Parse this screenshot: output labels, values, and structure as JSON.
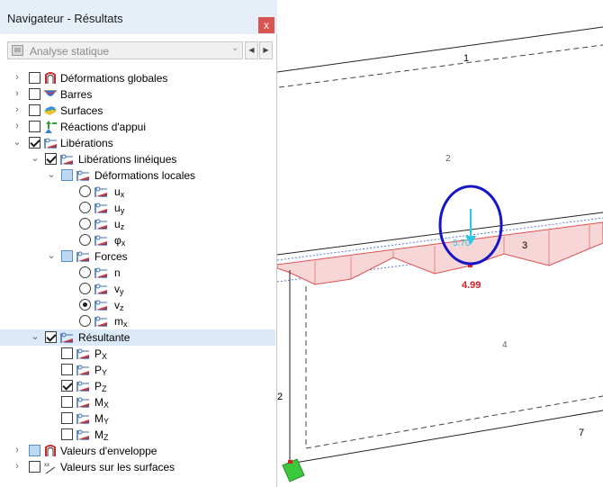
{
  "window": {
    "title": "Navigateur - Résultats",
    "close_glyph": "x"
  },
  "combo": {
    "value": "Analyse statique",
    "arrow": "⌄"
  },
  "nav_buttons": {
    "prev": "◀",
    "next": "▶"
  },
  "tree": [
    {
      "label": "Déformations globales",
      "state": "unchecked",
      "icon": "global-deformation-icon",
      "expander": "collapsed"
    },
    {
      "label": "Barres",
      "state": "unchecked",
      "icon": "members-icon",
      "expander": "collapsed"
    },
    {
      "label": "Surfaces",
      "state": "unchecked",
      "icon": "surfaces-icon",
      "expander": "collapsed"
    },
    {
      "label": "Réactions d'appui",
      "state": "unchecked",
      "icon": "support-reactions-icon",
      "expander": "collapsed"
    },
    {
      "label": "Libérations",
      "state": "checked",
      "icon": "releases-icon",
      "expander": "expanded"
    },
    {
      "label": "Libérations linéiques",
      "state": "checked",
      "icon": "line-release-icon",
      "expander": "expanded"
    },
    {
      "label": "Déformations locales",
      "state": "partial",
      "icon": "line-release-icon",
      "expander": "expanded"
    },
    {
      "label": "u",
      "sub": "x",
      "state": "radio-off",
      "icon": "line-release-icon"
    },
    {
      "label": "u",
      "sub": "y",
      "state": "radio-off",
      "icon": "line-release-icon"
    },
    {
      "label": "u",
      "sub": "z",
      "state": "radio-off",
      "icon": "line-release-icon"
    },
    {
      "label": "φ",
      "sub": "x",
      "state": "radio-off",
      "icon": "line-release-icon"
    },
    {
      "label": "Forces",
      "state": "partial",
      "icon": "line-release-icon",
      "expander": "expanded"
    },
    {
      "label": "n",
      "sub": "",
      "state": "radio-off",
      "icon": "line-release-icon"
    },
    {
      "label": "v",
      "sub": "y",
      "state": "radio-off",
      "icon": "line-release-icon"
    },
    {
      "label": "v",
      "sub": "z",
      "state": "radio-on",
      "icon": "line-release-icon"
    },
    {
      "label": "m",
      "sub": "x",
      "state": "radio-off",
      "icon": "line-release-icon"
    },
    {
      "label": "Résultante",
      "state": "checked",
      "icon": "line-release-icon",
      "expander": "expanded",
      "selected": true
    },
    {
      "label": "P",
      "sub": "X",
      "state": "unchecked",
      "icon": "line-release-icon"
    },
    {
      "label": "P",
      "sub": "Y",
      "state": "unchecked",
      "icon": "line-release-icon"
    },
    {
      "label": "P",
      "sub": "Z",
      "state": "checked",
      "icon": "line-release-icon"
    },
    {
      "label": "M",
      "sub": "X",
      "state": "unchecked",
      "icon": "line-release-icon"
    },
    {
      "label": "M",
      "sub": "Y",
      "state": "unchecked",
      "icon": "line-release-icon"
    },
    {
      "label": "M",
      "sub": "Z",
      "state": "unchecked",
      "icon": "line-release-icon"
    },
    {
      "label": "Valeurs d'enveloppe",
      "state": "partial",
      "icon": "envelope-icon",
      "expander": "collapsed"
    },
    {
      "label": "Valeurs sur les surfaces",
      "state": "unchecked",
      "icon": "surface-values-icon",
      "expander": "collapsed"
    }
  ],
  "viewport": {
    "line_labels": [
      "1",
      "2",
      "3",
      "4",
      "7",
      "2"
    ],
    "result_value": "4.99",
    "resultant_value": "5.70",
    "colors": {
      "diagram_fill": "#f6d6d6",
      "diagram_line": "#e05050",
      "highlight": "#1616c8",
      "arrow": "#27c8e8",
      "support": "#3cc83c"
    }
  }
}
